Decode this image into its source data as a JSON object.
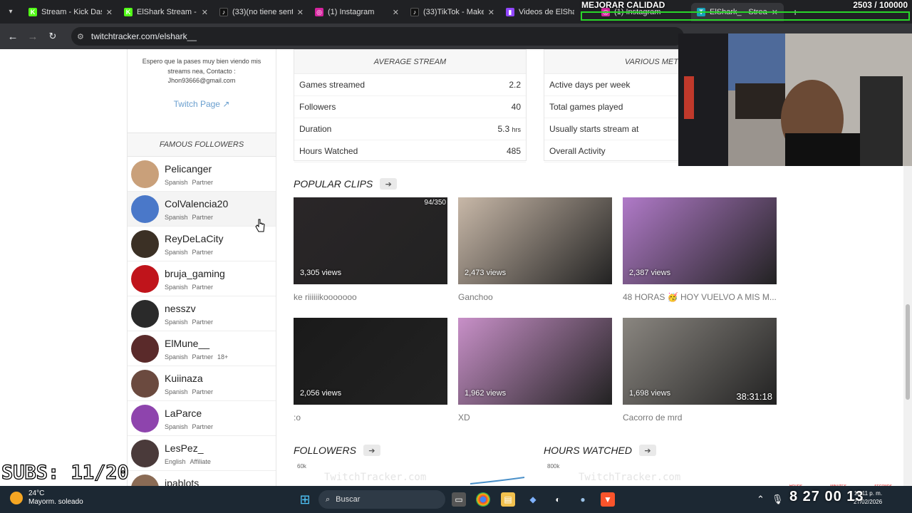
{
  "browser": {
    "tabs": [
      {
        "label": "Stream - Kick Dash",
        "favicon": "kick-icon",
        "color": "#53fc18"
      },
      {
        "label": "ElShark Stream - V",
        "favicon": "kick-icon",
        "color": "#53fc18"
      },
      {
        "label": "(33)(no tiene senti",
        "favicon": "tiktok-icon",
        "color": "#111111"
      },
      {
        "label": "(1) Instagram",
        "favicon": "instagram-icon",
        "color": "#d6249f"
      },
      {
        "label": "(33)TikTok - Make",
        "favicon": "tiktok-icon",
        "color": "#111111"
      },
      {
        "label": "Videos de ElShark",
        "favicon": "twitch-icon",
        "color": "#9146ff"
      },
      {
        "label": "(1) Instagram",
        "favicon": "instagram-icon",
        "color": "#d6249f"
      },
      {
        "label": "ElShark_ - Stream",
        "favicon": "twitchtracker-icon",
        "color": "#17a2b8"
      }
    ],
    "url": "twitchtracker.com/elshark__"
  },
  "bio": {
    "description": "Espero que la pases muy bien viendo mis streams nea, Contacto : Jhon93666@gmail.com",
    "twitch_link": "Twitch Page"
  },
  "famous_followers": {
    "title": "FAMOUS FOLLOWERS",
    "items": [
      {
        "name": "Pelicanger",
        "lang": "Spanish",
        "status": "Partner",
        "extra": "",
        "avatar": "#c9a07a"
      },
      {
        "name": "ColValencia20",
        "lang": "Spanish",
        "status": "Partner",
        "extra": "",
        "avatar": "#4a78c9"
      },
      {
        "name": "ReyDeLaCity",
        "lang": "Spanish",
        "status": "Partner",
        "extra": "",
        "avatar": "#3b3025"
      },
      {
        "name": "bruja_gaming",
        "lang": "Spanish",
        "status": "Partner",
        "extra": "",
        "avatar": "#c0141b"
      },
      {
        "name": "nesszv",
        "lang": "Spanish",
        "status": "Partner",
        "extra": "",
        "avatar": "#2a2a2a"
      },
      {
        "name": "ElMune__",
        "lang": "Spanish",
        "status": "Partner",
        "extra": "18+",
        "avatar": "#5a2a2a"
      },
      {
        "name": "Kuiinaza",
        "lang": "Spanish",
        "status": "Partner",
        "extra": "",
        "avatar": "#6b4a3f"
      },
      {
        "name": "LaParce",
        "lang": "Spanish",
        "status": "Partner",
        "extra": "",
        "avatar": "#8e44ad"
      },
      {
        "name": "LesPez_",
        "lang": "English",
        "status": "Affiliate",
        "extra": "",
        "avatar": "#4a3a3a"
      },
      {
        "name": "jpablots",
        "lang": "",
        "status": "",
        "extra": "",
        "avatar": "#8a6b55"
      }
    ]
  },
  "average_stream": {
    "title": "AVERAGE STREAM",
    "rows": [
      {
        "label": "Games streamed",
        "value": "2.2",
        "unit": ""
      },
      {
        "label": "Followers",
        "value": "40",
        "unit": ""
      },
      {
        "label": "Duration",
        "value": "5.3",
        "unit": "hrs"
      },
      {
        "label": "Hours Watched",
        "value": "485",
        "unit": ""
      }
    ]
  },
  "various_metrics": {
    "title": "VARIOUS MET",
    "rows": [
      {
        "label": "Active days per week"
      },
      {
        "label": "Total games played"
      },
      {
        "label": "Usually starts stream at"
      },
      {
        "label": "Overall Activity"
      }
    ]
  },
  "popular_clips": {
    "title": "POPULAR CLIPS",
    "clips": [
      {
        "views": "3,305 views",
        "title": "ke riiiiiikooooooo",
        "corner": "94/350",
        "timestamp": "",
        "bg": "#2a2628"
      },
      {
        "views": "2,473 views",
        "title": "Ganchoo",
        "corner": "",
        "timestamp": "",
        "bg": "#c8b8a8"
      },
      {
        "views": "2,387 views",
        "title": "48 HORAS 🥳 HOY VUELVO A MIS M...",
        "corner": "",
        "timestamp": "",
        "bg": "#b07ac8"
      },
      {
        "views": "2,056 views",
        "title": ":o",
        "corner": "",
        "timestamp": "",
        "bg": "#1a1a1a"
      },
      {
        "views": "1,962 views",
        "title": "XD",
        "corner": "",
        "timestamp": "",
        "bg": "#c890c8"
      },
      {
        "views": "1,698 views",
        "title": "Cacorro de mrd",
        "corner": "",
        "timestamp": "38:31:18",
        "bg": "#8a8680"
      }
    ]
  },
  "followers_chart": {
    "title": "FOLLOWERS",
    "axis_top": "60k",
    "watermark": "TwitchTracker.com"
  },
  "hours_chart": {
    "title": "HOURS WATCHED",
    "axis_top": "800k",
    "watermark": "TwitchTracker.com"
  },
  "overlay": {
    "quality": "MEJORAR CALIDAD",
    "sub_counter": "2503 / 100000",
    "subs_goal": "SUBS: 11/20",
    "timer": "8 27  00  13",
    "timer_labels": [
      "HOURS",
      "MINUTES",
      "SECONDS"
    ]
  },
  "taskbar": {
    "temp": "24°C",
    "weather": "Mayorm. soleado",
    "search": "Buscar",
    "time": "12:11 p. m.",
    "date": "27/02/2026",
    "lang": "ESP LAA"
  }
}
